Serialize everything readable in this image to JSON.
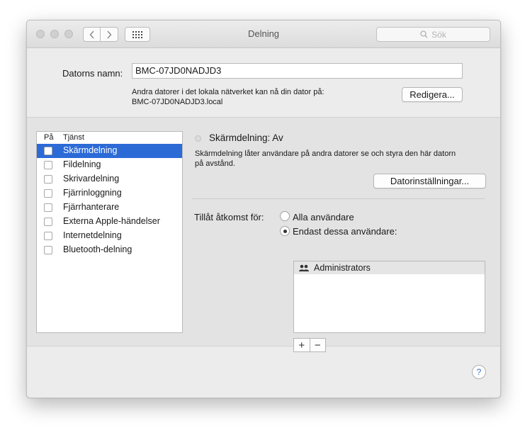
{
  "window": {
    "title": "Delning",
    "search_placeholder": "Sök"
  },
  "computer": {
    "name_label": "Datorns namn:",
    "name_value": "BMC-07JD0NADJD3",
    "info_line1": "Andra datorer i det lokala nätverket kan nå din dator på:",
    "info_line2": "BMC-07JD0NADJD3.local",
    "edit_button": "Redigera..."
  },
  "services": {
    "col_on": "På",
    "col_service": "Tjänst",
    "items": [
      {
        "label": "Skärmdelning",
        "checked": false,
        "selected": true
      },
      {
        "label": "Fildelning",
        "checked": false,
        "selected": false
      },
      {
        "label": "Skrivardelning",
        "checked": false,
        "selected": false
      },
      {
        "label": "Fjärrinloggning",
        "checked": false,
        "selected": false
      },
      {
        "label": "Fjärrhanterare",
        "checked": false,
        "selected": false
      },
      {
        "label": "Externa Apple-händelser",
        "checked": false,
        "selected": false
      },
      {
        "label": "Internetdelning",
        "checked": false,
        "selected": false
      },
      {
        "label": "Bluetooth-delning",
        "checked": false,
        "selected": false
      }
    ]
  },
  "detail": {
    "status": "Skärmdelning: Av",
    "desc_line1": "Skärmdelning låter användare på andra datorer se och styra den här datorn",
    "desc_line2": "på avstånd.",
    "settings_button": "Datorinställningar...",
    "access_label": "Tillåt åtkomst för:",
    "option_all": "Alla användare",
    "option_only": "Endast dessa användare:",
    "selected_option": "only",
    "users": [
      "Administrators"
    ],
    "add_symbol": "+",
    "remove_symbol": "−"
  },
  "help_symbol": "?",
  "colors": {
    "selection": "#2c6ad6",
    "help_accent": "#3b6fd6"
  }
}
